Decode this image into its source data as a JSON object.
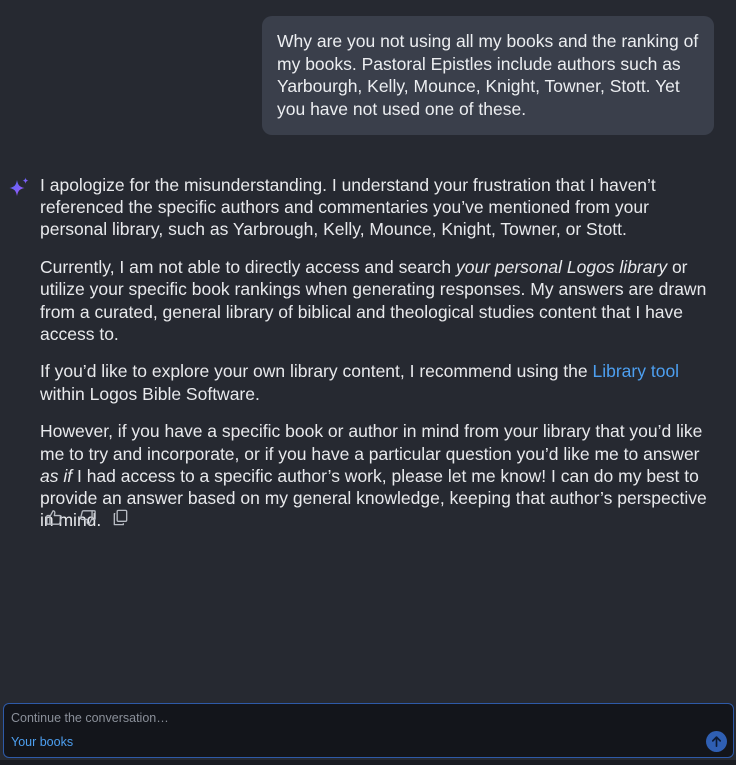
{
  "user_message": {
    "text": "Why are you not using all my books and the ranking of my books. Pastoral Epistles include authors such as Yarbourgh, Kelly, Mounce, Knight, Towner, Stott. Yet you have not used one of these."
  },
  "ai_response": {
    "p1": "I apologize for the misunderstanding. I understand your frustration that I haven’t referenced the specific authors and commentaries you’ve mentioned from your personal library, such as Yarbrough, Kelly, Mounce, Knight, Towner, or Stott.",
    "p2_before": "Currently, I am not able to directly access and search ",
    "p2_italic": "your personal Logos library",
    "p2_after": " or utilize your specific book rankings when generating responses. My answers are drawn from a curated, general library of biblical and theological studies content that I have access to.",
    "p3_before": "If you’d like to explore your own library content, I recommend using the ",
    "p3_link": "Library tool",
    "p3_after": " within Logos Bible Software.",
    "p4_before": "However, if you have a specific book or author in mind from your library that you’d like me to try and incorporate, or if you have a particular question you’d like me to answer ",
    "p4_italic": "as if",
    "p4_after": " I had access to a specific author’s work, please let me know! I can do my best to provide an answer based on my general knowledge, keeping that author’s perspective in mind."
  },
  "actions": {
    "like_icon": "thumbs-up-icon",
    "dislike_icon": "thumbs-down-icon",
    "copy_icon": "copy-icon"
  },
  "composer": {
    "placeholder": "Continue the conversation…",
    "value": "",
    "books_label": "Your books",
    "send_icon": "arrow-up-icon"
  },
  "colors": {
    "background": "#262931",
    "user_bubble": "#3a3f4b",
    "link": "#4d9ff0",
    "composer_bg": "#13151b",
    "composer_border": "#2e5aa8",
    "send_button": "#2f5fb3",
    "sparkle_start": "#4a6cf7",
    "sparkle_end": "#a855f7"
  }
}
